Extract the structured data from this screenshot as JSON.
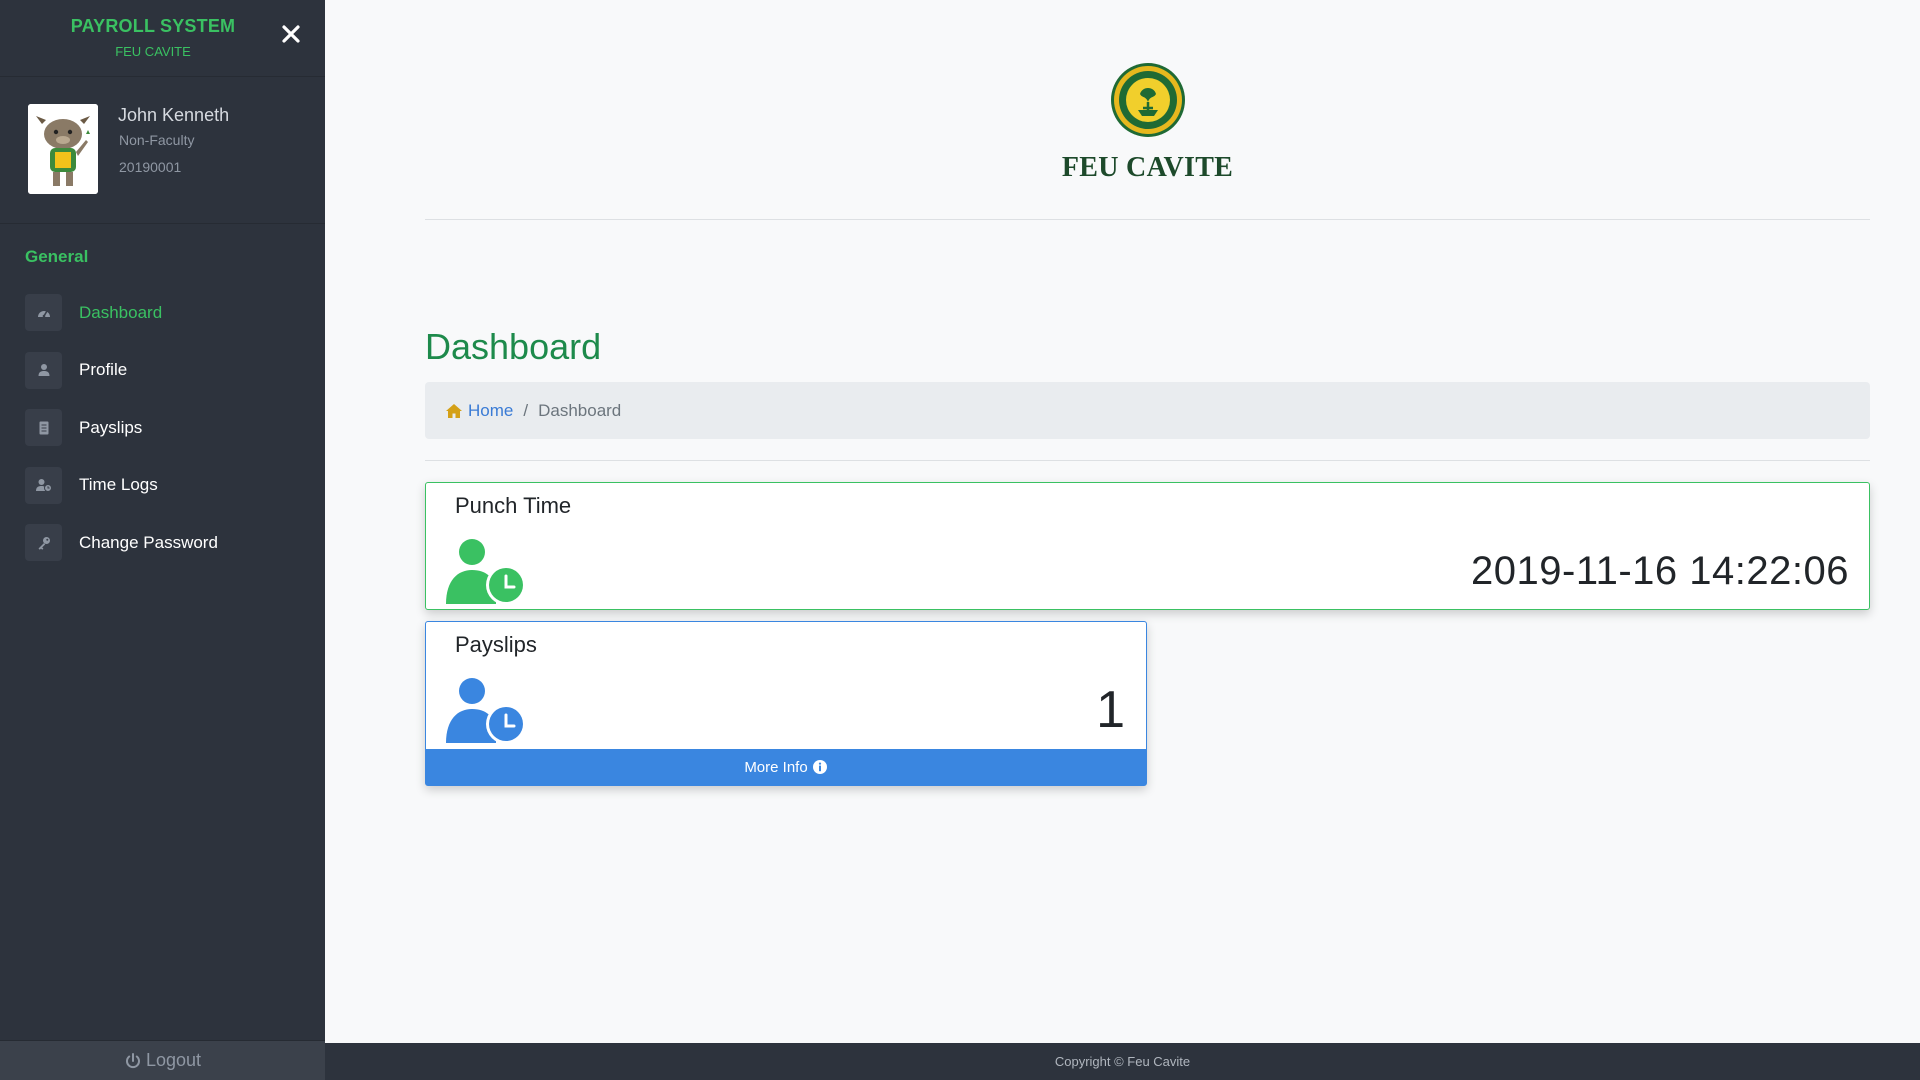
{
  "sidebar": {
    "title": "PAYROLL SYSTEM",
    "subtitle": "FEU CAVITE",
    "close_icon": "close-icon",
    "user": {
      "name": "John Kenneth",
      "role": "Non-Faculty",
      "id": "20190001"
    },
    "section_label": "General",
    "items": [
      {
        "label": "Dashboard",
        "icon": "dashboard-icon",
        "active": true
      },
      {
        "label": "Profile",
        "icon": "user-icon",
        "active": false
      },
      {
        "label": "Payslips",
        "icon": "document-icon",
        "active": false
      },
      {
        "label": "Time Logs",
        "icon": "user-clock-icon",
        "active": false
      },
      {
        "label": "Change Password",
        "icon": "key-icon",
        "active": false
      }
    ],
    "logout_label": "Logout"
  },
  "brand": {
    "name": "FEU CAVITE"
  },
  "page": {
    "title": "Dashboard"
  },
  "breadcrumb": {
    "home": "Home",
    "current": "Dashboard"
  },
  "cards": {
    "punch": {
      "title": "Punch Time",
      "value": "2019-11-16 14:22:06",
      "color": "#3ac162"
    },
    "payslips": {
      "title": "Payslips",
      "value": "1",
      "more_info": "More Info",
      "color": "#3a86e0"
    }
  },
  "footer": {
    "text": "Copyright © Feu Cavite"
  },
  "colors": {
    "sidebar_bg": "#2d333d",
    "accent_green": "#3ac162",
    "title_green": "#1d8a4b",
    "link_blue": "#3a7bd5"
  }
}
